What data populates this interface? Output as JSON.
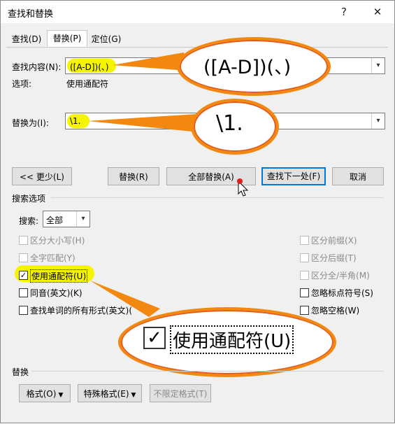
{
  "title": "查找和替换",
  "help_glyph": "?",
  "close_glyph": "✕",
  "tabs": [
    "查找(D)",
    "替换(P)",
    "定位(G)"
  ],
  "find": {
    "label": "查找内容(N):",
    "value": "([A-D])(、)"
  },
  "options": {
    "label": "选项:",
    "value": "使用通配符"
  },
  "replace": {
    "label": "替换为(I):",
    "value": "\\1."
  },
  "callout_find": "([A-D])(、)",
  "callout_replace": "\\1.",
  "buttons": {
    "less": "<< 更少(L)",
    "replace": "替换(R)",
    "replace_all": "全部替换(A)",
    "find_next": "查找下一处(F)",
    "cancel": "取消"
  },
  "search_options_title": "搜索选项",
  "search": {
    "label": "搜索:",
    "value": "全部"
  },
  "checkboxes_left": [
    {
      "label": "区分大小写(H)",
      "checked": false,
      "disabled": true
    },
    {
      "label": "全字匹配(Y)",
      "checked": false,
      "disabled": true
    },
    {
      "label": "使用通配符(U)",
      "checked": true,
      "disabled": false
    },
    {
      "label": "同音(英文)(K)",
      "checked": false,
      "disabled": false
    },
    {
      "label": "查找单词的所有形式(英文)(",
      "checked": false,
      "disabled": false
    }
  ],
  "checkboxes_right": [
    {
      "label": "区分前缀(X)",
      "checked": false,
      "disabled": true
    },
    {
      "label": "区分后缀(T)",
      "checked": false,
      "disabled": true
    },
    {
      "label": "区分全/半角(M)",
      "checked": false,
      "disabled": true
    },
    {
      "label": "忽略标点符号(S)",
      "checked": false,
      "disabled": false
    },
    {
      "label": "忽略空格(W)",
      "checked": false,
      "disabled": false
    }
  ],
  "callout_wildcard": "使用通配符(U)",
  "replace_section_title": "替换",
  "bottom_buttons": {
    "format": "格式(O)",
    "special": "特殊格式(E)",
    "no_format": "不限定格式(T)"
  },
  "colors": {
    "highlight": "#f5f500",
    "callout_border": "#f2880f",
    "accent": "#0078d7"
  }
}
